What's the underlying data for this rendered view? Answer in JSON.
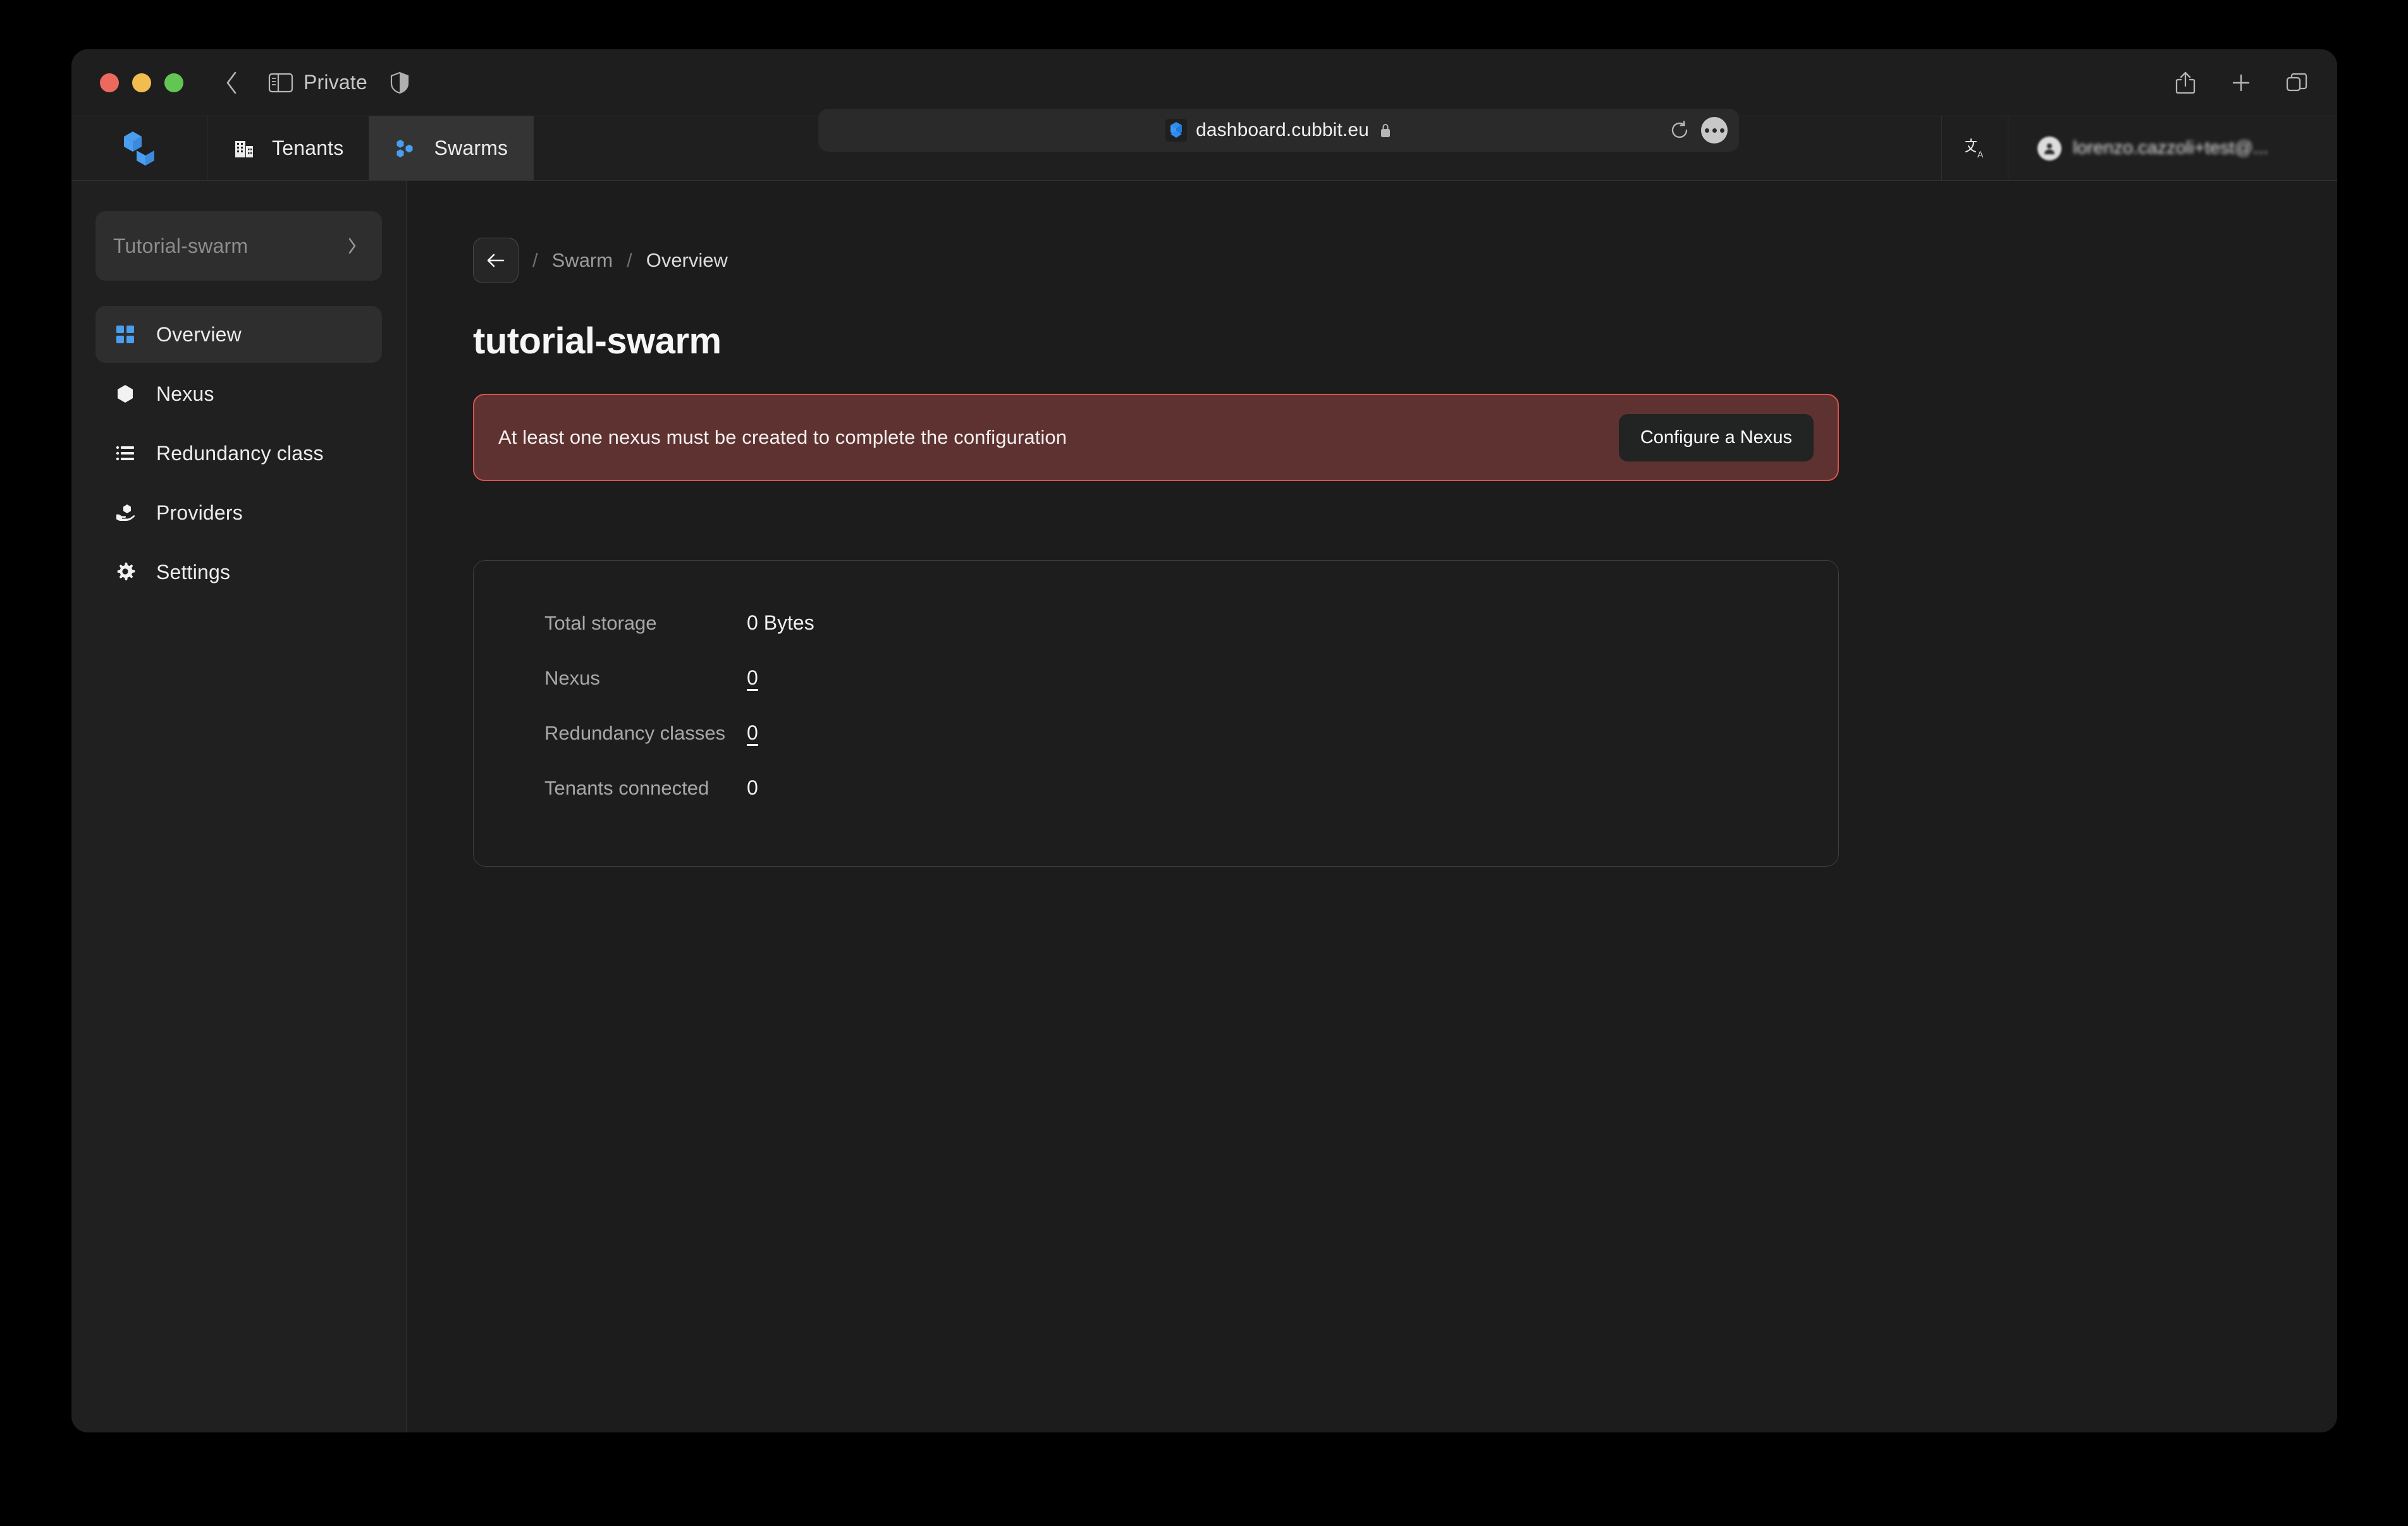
{
  "browser": {
    "private_label": "Private",
    "url": "dashboard.cubbit.eu",
    "icons": {
      "back": "back-chevron-icon",
      "sidebar": "sidebar-toggle-icon",
      "shield": "privacy-shield-icon",
      "favicon": "cubbit-favicon-icon",
      "lock": "lock-icon",
      "reload": "reload-icon",
      "more": "more-options-icon",
      "share": "share-icon",
      "new_tab": "plus-icon",
      "tabs": "tab-overview-icon"
    }
  },
  "app_header": {
    "logo": "cubbit-logo-icon",
    "tabs": [
      {
        "label": "Tenants",
        "icon": "building-icon",
        "active": false
      },
      {
        "label": "Swarms",
        "icon": "swarm-hexagons-icon",
        "active": true
      }
    ],
    "translate_icon": "translate-icon",
    "user_email": "lorenzo.cazzoli+test@..."
  },
  "sidebar": {
    "swarm_selector": {
      "label": "Tutorial-swarm",
      "chevron": "chevron-right-icon"
    },
    "items": [
      {
        "label": "Overview",
        "icon": "grid-icon",
        "active": true
      },
      {
        "label": "Nexus",
        "icon": "hexagon-icon",
        "active": false
      },
      {
        "label": "Redundancy class",
        "icon": "list-icon",
        "active": false
      },
      {
        "label": "Providers",
        "icon": "hand-hexagon-icon",
        "active": false
      },
      {
        "label": "Settings",
        "icon": "gear-icon",
        "active": false
      }
    ]
  },
  "main": {
    "breadcrumb": {
      "back_icon": "arrow-left-icon",
      "separator": "/",
      "parent": "Swarm",
      "current": "Overview"
    },
    "page_title": "tutorial-swarm",
    "alert": {
      "message": "At least one nexus must be created to complete the configuration",
      "button_label": "Configure a Nexus",
      "border_color": "#d9534f",
      "background_color": "#5e3230"
    },
    "stats": [
      {
        "label": "Total storage",
        "value": "0 Bytes",
        "is_link": false
      },
      {
        "label": "Nexus",
        "value": "0",
        "is_link": true
      },
      {
        "label": "Redundancy classes",
        "value": "0",
        "is_link": true
      },
      {
        "label": "Tenants connected",
        "value": "0",
        "is_link": false
      }
    ]
  },
  "colors": {
    "accent": "#4a9ef0",
    "page_background": "#1c1c1c",
    "sidebar_background": "#202020"
  }
}
